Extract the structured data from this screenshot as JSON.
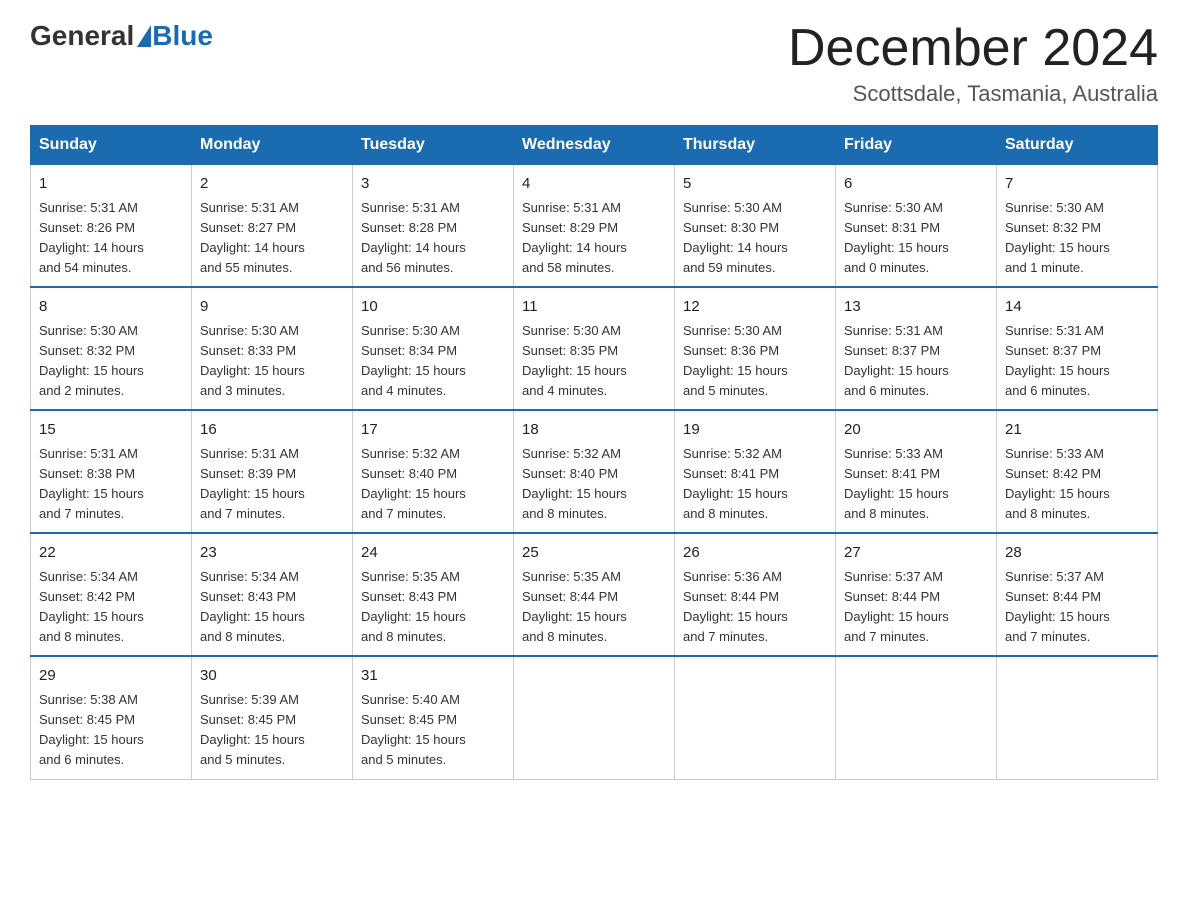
{
  "logo": {
    "general": "General",
    "blue": "Blue"
  },
  "title": "December 2024",
  "subtitle": "Scottsdale, Tasmania, Australia",
  "headers": [
    "Sunday",
    "Monday",
    "Tuesday",
    "Wednesday",
    "Thursday",
    "Friday",
    "Saturday"
  ],
  "weeks": [
    [
      {
        "day": "1",
        "info": "Sunrise: 5:31 AM\nSunset: 8:26 PM\nDaylight: 14 hours\nand 54 minutes."
      },
      {
        "day": "2",
        "info": "Sunrise: 5:31 AM\nSunset: 8:27 PM\nDaylight: 14 hours\nand 55 minutes."
      },
      {
        "day": "3",
        "info": "Sunrise: 5:31 AM\nSunset: 8:28 PM\nDaylight: 14 hours\nand 56 minutes."
      },
      {
        "day": "4",
        "info": "Sunrise: 5:31 AM\nSunset: 8:29 PM\nDaylight: 14 hours\nand 58 minutes."
      },
      {
        "day": "5",
        "info": "Sunrise: 5:30 AM\nSunset: 8:30 PM\nDaylight: 14 hours\nand 59 minutes."
      },
      {
        "day": "6",
        "info": "Sunrise: 5:30 AM\nSunset: 8:31 PM\nDaylight: 15 hours\nand 0 minutes."
      },
      {
        "day": "7",
        "info": "Sunrise: 5:30 AM\nSunset: 8:32 PM\nDaylight: 15 hours\nand 1 minute."
      }
    ],
    [
      {
        "day": "8",
        "info": "Sunrise: 5:30 AM\nSunset: 8:32 PM\nDaylight: 15 hours\nand 2 minutes."
      },
      {
        "day": "9",
        "info": "Sunrise: 5:30 AM\nSunset: 8:33 PM\nDaylight: 15 hours\nand 3 minutes."
      },
      {
        "day": "10",
        "info": "Sunrise: 5:30 AM\nSunset: 8:34 PM\nDaylight: 15 hours\nand 4 minutes."
      },
      {
        "day": "11",
        "info": "Sunrise: 5:30 AM\nSunset: 8:35 PM\nDaylight: 15 hours\nand 4 minutes."
      },
      {
        "day": "12",
        "info": "Sunrise: 5:30 AM\nSunset: 8:36 PM\nDaylight: 15 hours\nand 5 minutes."
      },
      {
        "day": "13",
        "info": "Sunrise: 5:31 AM\nSunset: 8:37 PM\nDaylight: 15 hours\nand 6 minutes."
      },
      {
        "day": "14",
        "info": "Sunrise: 5:31 AM\nSunset: 8:37 PM\nDaylight: 15 hours\nand 6 minutes."
      }
    ],
    [
      {
        "day": "15",
        "info": "Sunrise: 5:31 AM\nSunset: 8:38 PM\nDaylight: 15 hours\nand 7 minutes."
      },
      {
        "day": "16",
        "info": "Sunrise: 5:31 AM\nSunset: 8:39 PM\nDaylight: 15 hours\nand 7 minutes."
      },
      {
        "day": "17",
        "info": "Sunrise: 5:32 AM\nSunset: 8:40 PM\nDaylight: 15 hours\nand 7 minutes."
      },
      {
        "day": "18",
        "info": "Sunrise: 5:32 AM\nSunset: 8:40 PM\nDaylight: 15 hours\nand 8 minutes."
      },
      {
        "day": "19",
        "info": "Sunrise: 5:32 AM\nSunset: 8:41 PM\nDaylight: 15 hours\nand 8 minutes."
      },
      {
        "day": "20",
        "info": "Sunrise: 5:33 AM\nSunset: 8:41 PM\nDaylight: 15 hours\nand 8 minutes."
      },
      {
        "day": "21",
        "info": "Sunrise: 5:33 AM\nSunset: 8:42 PM\nDaylight: 15 hours\nand 8 minutes."
      }
    ],
    [
      {
        "day": "22",
        "info": "Sunrise: 5:34 AM\nSunset: 8:42 PM\nDaylight: 15 hours\nand 8 minutes."
      },
      {
        "day": "23",
        "info": "Sunrise: 5:34 AM\nSunset: 8:43 PM\nDaylight: 15 hours\nand 8 minutes."
      },
      {
        "day": "24",
        "info": "Sunrise: 5:35 AM\nSunset: 8:43 PM\nDaylight: 15 hours\nand 8 minutes."
      },
      {
        "day": "25",
        "info": "Sunrise: 5:35 AM\nSunset: 8:44 PM\nDaylight: 15 hours\nand 8 minutes."
      },
      {
        "day": "26",
        "info": "Sunrise: 5:36 AM\nSunset: 8:44 PM\nDaylight: 15 hours\nand 7 minutes."
      },
      {
        "day": "27",
        "info": "Sunrise: 5:37 AM\nSunset: 8:44 PM\nDaylight: 15 hours\nand 7 minutes."
      },
      {
        "day": "28",
        "info": "Sunrise: 5:37 AM\nSunset: 8:44 PM\nDaylight: 15 hours\nand 7 minutes."
      }
    ],
    [
      {
        "day": "29",
        "info": "Sunrise: 5:38 AM\nSunset: 8:45 PM\nDaylight: 15 hours\nand 6 minutes."
      },
      {
        "day": "30",
        "info": "Sunrise: 5:39 AM\nSunset: 8:45 PM\nDaylight: 15 hours\nand 5 minutes."
      },
      {
        "day": "31",
        "info": "Sunrise: 5:40 AM\nSunset: 8:45 PM\nDaylight: 15 hours\nand 5 minutes."
      },
      {
        "day": "",
        "info": ""
      },
      {
        "day": "",
        "info": ""
      },
      {
        "day": "",
        "info": ""
      },
      {
        "day": "",
        "info": ""
      }
    ]
  ]
}
